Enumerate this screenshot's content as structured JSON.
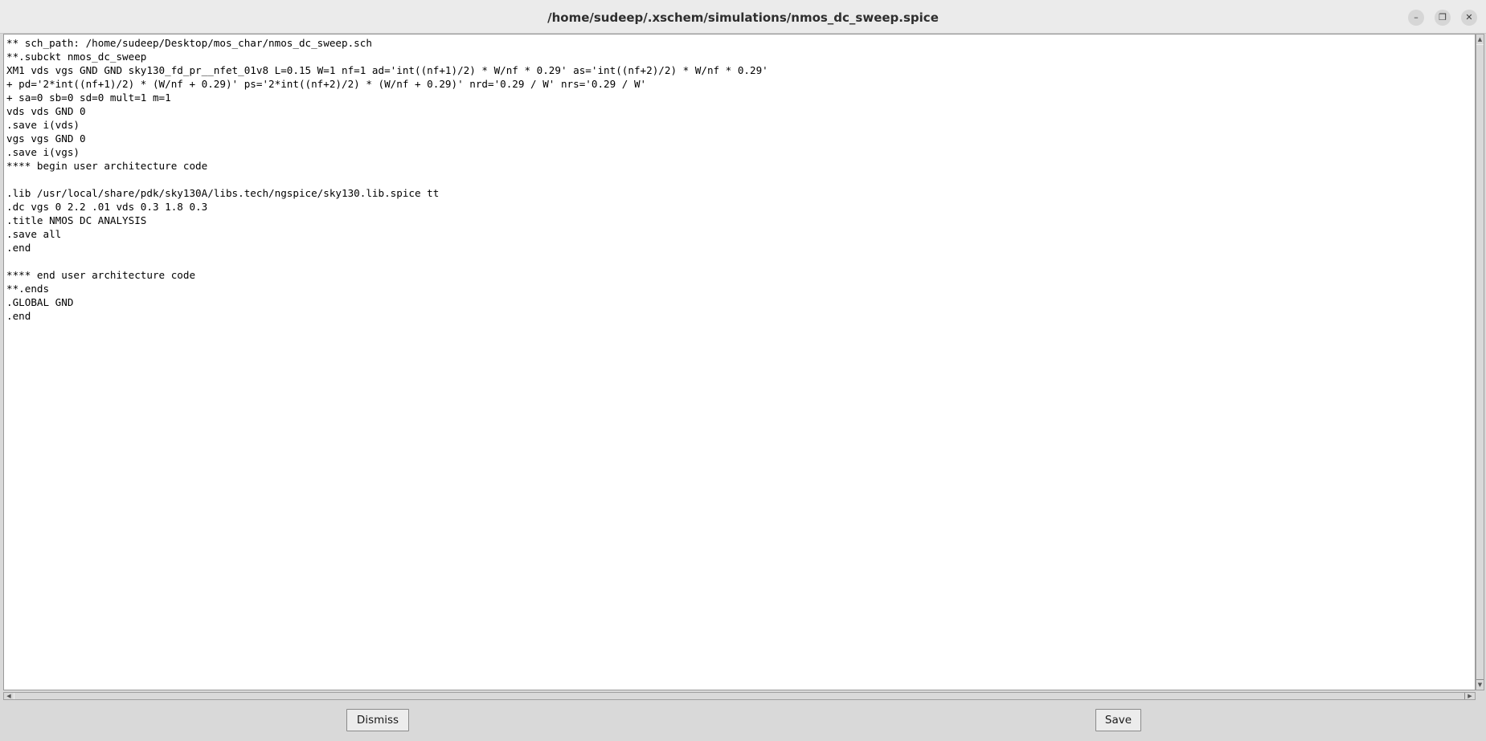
{
  "window": {
    "title": "/home/sudeep/.xschem/simulations/nmos_dc_sweep.spice",
    "controls": {
      "minimize_glyph": "–",
      "maximize_glyph": "❐",
      "close_glyph": "✕"
    }
  },
  "editor": {
    "lines": [
      "** sch_path: /home/sudeep/Desktop/mos_char/nmos_dc_sweep.sch",
      "**.subckt nmos_dc_sweep",
      "XM1 vds vgs GND GND sky130_fd_pr__nfet_01v8 L=0.15 W=1 nf=1 ad='int((nf+1)/2) * W/nf * 0.29' as='int((nf+2)/2) * W/nf * 0.29'",
      "+ pd='2*int((nf+1)/2) * (W/nf + 0.29)' ps='2*int((nf+2)/2) * (W/nf + 0.29)' nrd='0.29 / W' nrs='0.29 / W'",
      "+ sa=0 sb=0 sd=0 mult=1 m=1",
      "vds vds GND 0",
      ".save i(vds)",
      "vgs vgs GND 0",
      ".save i(vgs)",
      "**** begin user architecture code",
      "",
      ".lib /usr/local/share/pdk/sky130A/libs.tech/ngspice/sky130.lib.spice tt",
      ".dc vgs 0 2.2 .01 vds 0.3 1.8 0.3",
      ".title NMOS DC ANALYSIS",
      ".save all",
      ".end",
      "",
      "**** end user architecture code",
      "**.ends",
      ".GLOBAL GND",
      ".end"
    ]
  },
  "scrollbars": {
    "up_arrow": "▲",
    "down_arrow": "▼",
    "left_arrow": "◀",
    "right_arrow": "▶"
  },
  "buttons": {
    "dismiss_label": "Dismiss",
    "save_label": "Save"
  }
}
